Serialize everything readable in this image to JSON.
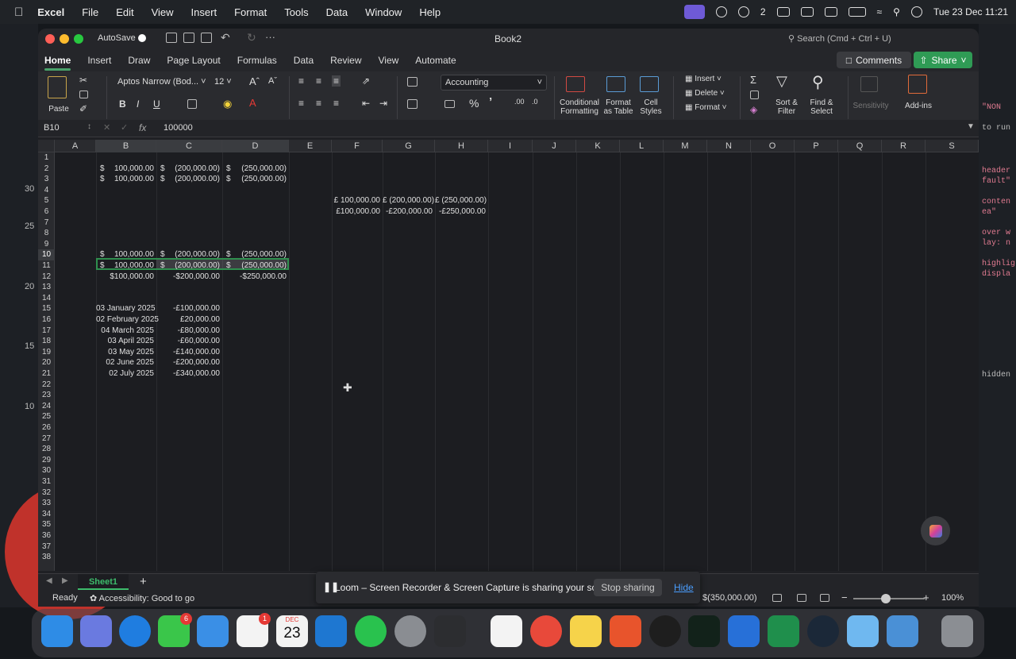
{
  "menubar": {
    "app": "Excel",
    "items": [
      "File",
      "Edit",
      "View",
      "Insert",
      "Format",
      "Tools",
      "Data",
      "Window",
      "Help"
    ],
    "battery_label": "2",
    "clock": "Tue 23 Dec  11:21"
  },
  "window": {
    "autosave": "AutoSave",
    "title": "Book2",
    "search": "Search (Cmd + Ctrl + U)"
  },
  "tabs": [
    "Home",
    "Insert",
    "Draw",
    "Page Layout",
    "Formulas",
    "Data",
    "Review",
    "View",
    "Automate"
  ],
  "buttons": {
    "comments": "Comments",
    "share": "Share"
  },
  "ribbon": {
    "paste": "Paste",
    "font_name": "Aptos Narrow (Bod...",
    "font_size": "12",
    "bold": "B",
    "italic": "I",
    "underline": "U",
    "number_format": "Accounting",
    "conditional_formatting": [
      "Conditional",
      "Formatting"
    ],
    "format_as_table": [
      "Format",
      "as Table"
    ],
    "cell_styles": [
      "Cell",
      "Styles"
    ],
    "insert": "Insert",
    "delete": "Delete",
    "format": "Format",
    "sort_filter": [
      "Sort &",
      "Filter"
    ],
    "find_select": [
      "Find &",
      "Select"
    ],
    "sensitivity": "Sensitivity",
    "add_ins": "Add-ins"
  },
  "formula_bar": {
    "name_box": "B10",
    "fx": "fx",
    "value": "100000"
  },
  "columns": [
    "A",
    "B",
    "C",
    "D",
    "E",
    "F",
    "G",
    "H",
    "I",
    "J",
    "K",
    "L",
    "M",
    "N",
    "O",
    "P",
    "Q",
    "R",
    "S"
  ],
  "rows": [
    "1",
    "2",
    "3",
    "4",
    "5",
    "6",
    "7",
    "8",
    "9",
    "10",
    "11",
    "12",
    "13",
    "14",
    "15",
    "16",
    "17",
    "18",
    "19",
    "20",
    "21",
    "22",
    "23",
    "24",
    "25",
    "26",
    "27",
    "28",
    "29",
    "30",
    "31",
    "32",
    "33",
    "34",
    "35",
    "36",
    "37",
    "38"
  ],
  "cells": {
    "r2": {
      "b": "100,000.00",
      "c": "(200,000.00)",
      "d": "(250,000.00)"
    },
    "r3": {
      "b": "100,000.00",
      "c": "(200,000.00)",
      "d": "(250,000.00)"
    },
    "r5": {
      "f": "£ 100,000.00",
      "g": "£ (200,000.00)",
      "h": "£ (250,000.00)"
    },
    "r6": {
      "f": "£100,000.00",
      "g": "-£200,000.00",
      "h": "-£250,000.00"
    },
    "r10": {
      "b": "100,000.00",
      "c": "(200,000.00)",
      "d": "(250,000.00)"
    },
    "r11": {
      "b": "100,000.00",
      "c": "(200,000.00)",
      "d": "(250,000.00)"
    },
    "r12": {
      "b": "$100,000.00",
      "c": "-$200,000.00",
      "d": "-$250,000.00"
    },
    "currency_symbol": "$",
    "dates": [
      "03 January 2025",
      "02 February 2025",
      "04 March 2025",
      "03 April 2025",
      "03 May 2025",
      "02 June 2025",
      "02 July 2025"
    ],
    "amounts": [
      "-£100,000.00",
      "£20,000.00",
      "-£80,000.00",
      "-£60,000.00",
      "-£140,000.00",
      "-£200,000.00",
      "-£340,000.00"
    ]
  },
  "sheet_tab": "Sheet1",
  "status": {
    "ready": "Ready",
    "accessibility": "Accessibility: Good to go",
    "sum": "$(350,000.00)",
    "zoom": "100%"
  },
  "loom": {
    "message": "Loom – Screen Recorder & Screen Capture is sharing your screen.",
    "stop": "Stop sharing",
    "hide": "Hide"
  },
  "dock": {
    "calendar_month": "DEC",
    "calendar_day": "23",
    "messages_badge": "6",
    "reminders_badge": "1"
  },
  "background": {
    "right_code": [
      "\"NON",
      "to run",
      "header",
      "fault\"",
      "conten",
      "ea\"",
      "over w",
      "lay: n",
      "highlig",
      "displa",
      "hidden"
    ],
    "left_axis": [
      "30",
      "25",
      "20",
      "15",
      "10"
    ]
  },
  "colors": {
    "accent_green": "#2f9b55",
    "selection": "#2f8f4e",
    "loom_link": "#4a9eff"
  }
}
